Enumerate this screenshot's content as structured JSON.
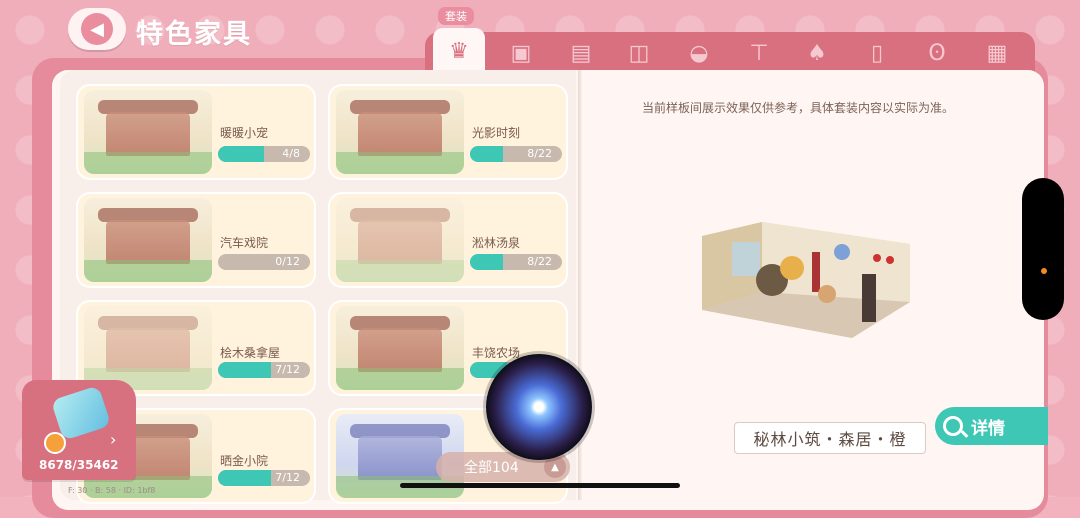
{
  "header": {
    "back_label": "‹",
    "title": "特色家具"
  },
  "tabs": {
    "active_label": "套装",
    "items": [
      {
        "icon": "armchair-set-icon",
        "glyph": "♛"
      },
      {
        "icon": "sofa-icon",
        "glyph": "▣"
      },
      {
        "icon": "bed-icon",
        "glyph": "▤"
      },
      {
        "icon": "oven-icon",
        "glyph": "◫"
      },
      {
        "icon": "bathtub-icon",
        "glyph": "◒"
      },
      {
        "icon": "table-icon",
        "glyph": "⊤"
      },
      {
        "icon": "lamp-icon",
        "glyph": "♠"
      },
      {
        "icon": "fridge-icon",
        "glyph": "▯"
      },
      {
        "icon": "teddy-bear-icon",
        "glyph": "ʘ"
      },
      {
        "icon": "wall-brick-icon",
        "glyph": "▦"
      }
    ]
  },
  "sets": [
    {
      "name": "暖暖小宠",
      "progress": "4/8",
      "fraction": 0.5
    },
    {
      "name": "光影时刻",
      "progress": "8/22",
      "fraction": 0.36
    },
    {
      "name": "汽车戏院",
      "progress": "0/12",
      "fraction": 0
    },
    {
      "name": "淞林汤泉",
      "progress": "8/22",
      "fraction": 0.36
    },
    {
      "name": "桧木桑拿屋",
      "progress": "7/12",
      "fraction": 0.58
    },
    {
      "name": "丰饶农场",
      "progress": "",
      "fraction": 0.4
    },
    {
      "name": "晒金小院",
      "progress": "7/12",
      "fraction": 0.58
    },
    {
      "name": "",
      "progress": "",
      "fraction": 0
    }
  ],
  "preview": {
    "notice": "当前样板间展示效果仅供参考，具体套装内容以实际为准。",
    "set_name": "秘林小筑・森居・橙",
    "detail_label": "详情"
  },
  "filter": {
    "label": "全部104"
  },
  "collection": {
    "count": "8678/35462"
  },
  "debug_text": "F: 30 · B: 58 · ID: 1bf8"
}
